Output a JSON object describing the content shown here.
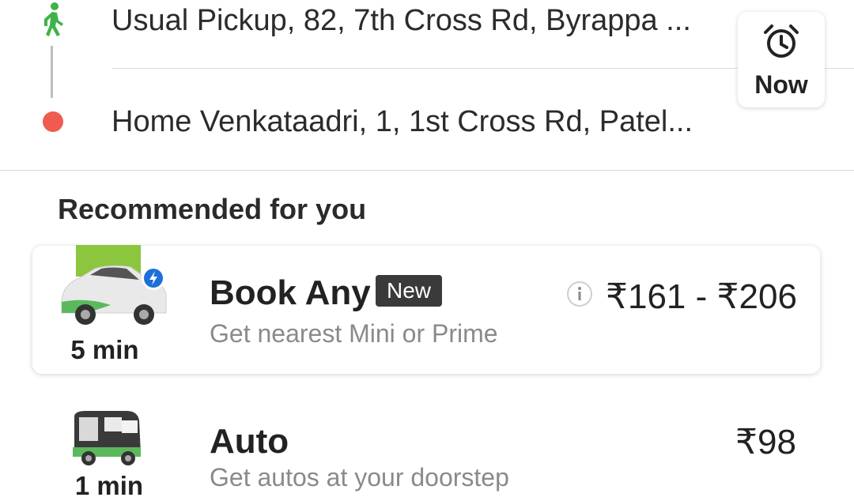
{
  "route": {
    "pickup": "Usual Pickup, 82, 7th Cross Rd, Byrappa ...",
    "drop": "Home Venkataadri, 1, 1st Cross Rd, Patel..."
  },
  "schedule": {
    "label": "Now",
    "icon": "alarm-clock-icon"
  },
  "section": {
    "title": "Recommended for you"
  },
  "rides": [
    {
      "name": "Book Any",
      "badge": "New",
      "subtitle": "Get nearest Mini or Prime",
      "price": "₹161 - ₹206",
      "eta": "5 min",
      "icon": "car-icon",
      "info_icon": "info-icon"
    },
    {
      "name": "Auto",
      "subtitle": "Get autos at your doorstep",
      "price": "₹98",
      "eta": "1 min",
      "icon": "auto-rickshaw-icon"
    }
  ],
  "colors": {
    "accent_green": "#4caf50",
    "drop_red": "#ef5b4f",
    "badge_dark": "#3a3a3a"
  }
}
